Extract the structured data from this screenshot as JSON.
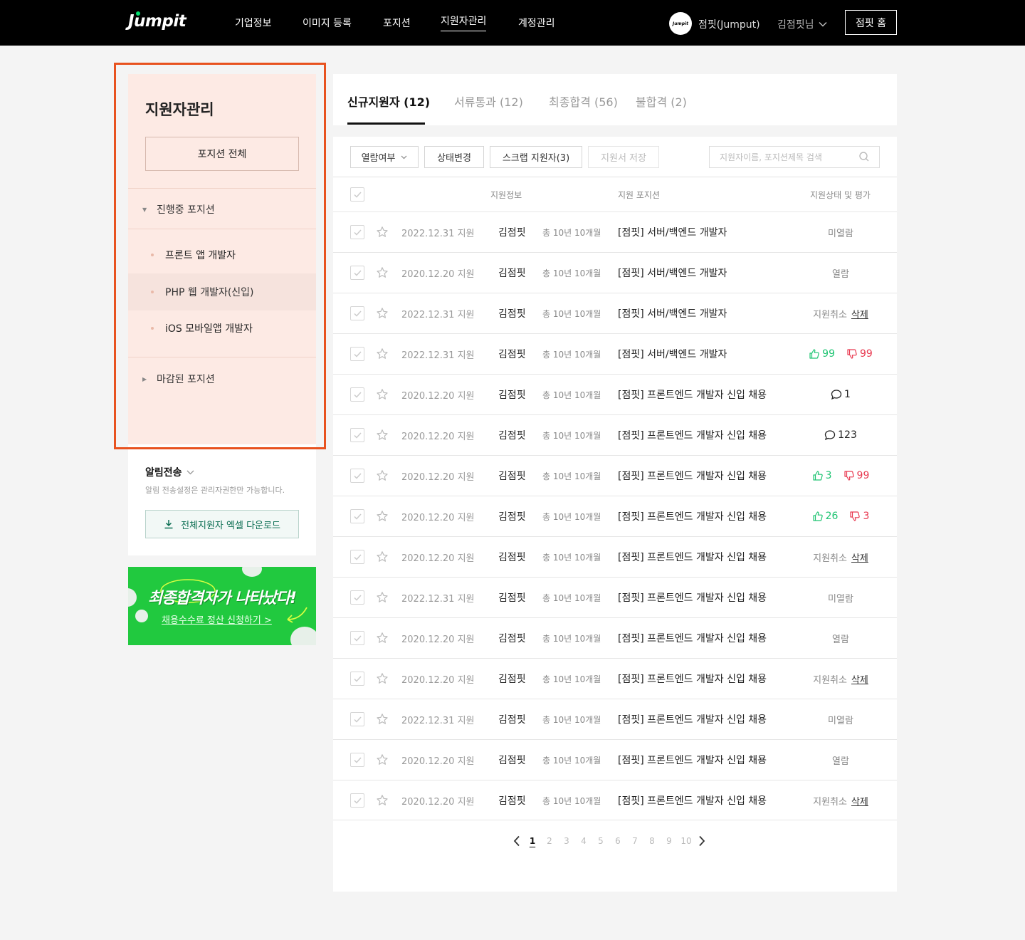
{
  "header": {
    "logo": "Jumpit",
    "nav": [
      "기업정보",
      "이미지 등록",
      "포지션",
      "지원자관리",
      "계정관리"
    ],
    "active_nav": "지원자관리",
    "company_avatar": "Jumpit",
    "company_name": "점핏(Jumput)",
    "user_name": "김점핏님",
    "home_button": "점핏 홈"
  },
  "sidebar": {
    "title": "지원자관리",
    "all_positions_button": "포지션 전체",
    "open_group": "진행중 포지션",
    "positions": [
      "프론트 앱 개발자",
      "PHP 웹 개발자(신입)",
      "iOS 모바일앱 개발자"
    ],
    "closed_group": "마감된 포지션",
    "alarm_title": "알림전송",
    "alarm_desc": "알림 전송설정은 관리자권한만 가능합니다.",
    "excel_button": "전체지원자 엑셀 다운로드",
    "banner_title": "최종합격자가 나타났다!",
    "banner_sub": "채용수수료 정산 신청하기 >"
  },
  "tabs": [
    {
      "label": "신규지원자 (12)"
    },
    {
      "label": "서류통과 (12)"
    },
    {
      "label": "최종합격 (56)"
    },
    {
      "label": "불합격 (2)"
    }
  ],
  "toolbar": {
    "read_filter": "열람여부",
    "change_status": "상태변경",
    "scrap": "스크랩 지원자(3)",
    "save_apps": "지원서 저장",
    "search_placeholder": "지원자이름, 포지션제목 검색"
  },
  "table": {
    "headers": {
      "info": "지원정보",
      "position": "지원 포지션",
      "status": "지원상태 및 평가"
    },
    "rows": [
      {
        "date": "2022.12.31 지원",
        "name": "김점핏",
        "career": "총 10년 10개월",
        "position": "[점핏] 서버/백엔드 개발자",
        "status": "미열람"
      },
      {
        "date": "2020.12.20 지원",
        "name": "김점핏",
        "career": "총 10년 10개월",
        "position": "[점핏] 서버/백엔드 개발자",
        "status": "열람"
      },
      {
        "date": "2022.12.31 지원",
        "name": "김점핏",
        "career": "총 10년 10개월",
        "position": "[점핏] 서버/백엔드 개발자",
        "status": "지원취소",
        "delete": "삭제"
      },
      {
        "date": "2022.12.31 지원",
        "name": "김점핏",
        "career": "총 10년 10개월",
        "position": "[점핏] 서버/백엔드 개발자",
        "likes": "99",
        "dislikes": "99"
      },
      {
        "date": "2020.12.20 지원",
        "name": "김점핏",
        "career": "총 10년 10개월",
        "position": "[점핏] 프론트엔드 개발자 신입 채용",
        "comments": "1"
      },
      {
        "date": "2020.12.20 지원",
        "name": "김점핏",
        "career": "총 10년 10개월",
        "position": "[점핏] 프론트엔드 개발자 신입 채용",
        "comments": "123"
      },
      {
        "date": "2020.12.20 지원",
        "name": "김점핏",
        "career": "총 10년 10개월",
        "position": "[점핏] 프론트엔드 개발자 신입 채용",
        "likes": "3",
        "dislikes": "99"
      },
      {
        "date": "2020.12.20 지원",
        "name": "김점핏",
        "career": "총 10년 10개월",
        "position": "[점핏] 프론트엔드 개발자 신입 채용",
        "likes": "26",
        "dislikes": "3"
      },
      {
        "date": "2020.12.20 지원",
        "name": "김점핏",
        "career": "총 10년 10개월",
        "position": "[점핏] 프론트엔드 개발자 신입 채용",
        "status": "지원취소",
        "delete": "삭제"
      },
      {
        "date": "2022.12.31 지원",
        "name": "김점핏",
        "career": "총 10년 10개월",
        "position": "[점핏] 프론트엔드 개발자 신입 채용",
        "status": "미열람"
      },
      {
        "date": "2020.12.20 지원",
        "name": "김점핏",
        "career": "총 10년 10개월",
        "position": "[점핏] 프론트엔드 개발자 신입 채용",
        "status": "열람"
      },
      {
        "date": "2020.12.20 지원",
        "name": "김점핏",
        "career": "총 10년 10개월",
        "position": "[점핏] 프론트엔드 개발자 신입 채용",
        "status": "지원취소",
        "delete": "삭제"
      },
      {
        "date": "2022.12.31 지원",
        "name": "김점핏",
        "career": "총 10년 10개월",
        "position": "[점핏] 프론트엔드 개발자 신입 채용",
        "status": "미열람"
      },
      {
        "date": "2020.12.20 지원",
        "name": "김점핏",
        "career": "총 10년 10개월",
        "position": "[점핏] 프론트엔드 개발자 신입 채용",
        "status": "열람"
      },
      {
        "date": "2020.12.20 지원",
        "name": "김점핏",
        "career": "총 10년 10개월",
        "position": "[점핏] 프론트엔드 개발자 신입 채용",
        "status": "지원취소",
        "delete": "삭제"
      }
    ]
  },
  "pagination": {
    "pages": [
      "1",
      "2",
      "3",
      "4",
      "5",
      "6",
      "7",
      "8",
      "9",
      "10"
    ],
    "current": "1"
  },
  "colors": {
    "accent_green": "#00dd6d",
    "like": "#1ec472",
    "dislike": "#e8384f",
    "highlight": "#e8521f",
    "sidebar_bg": "#fdeae4"
  }
}
